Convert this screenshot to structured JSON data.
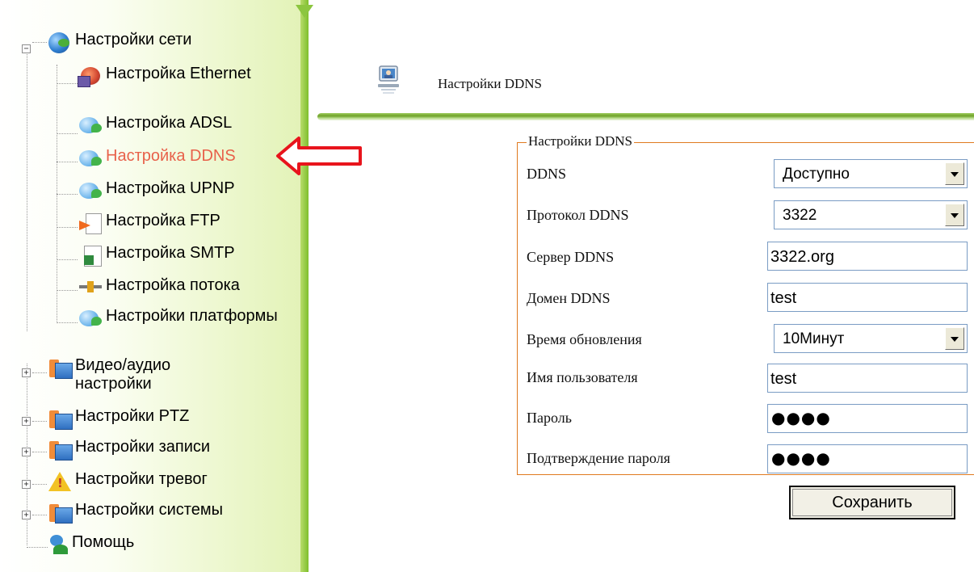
{
  "sidebar": {
    "items": [
      {
        "label": "Настройки сети",
        "icon": "globe-icon",
        "expander": "−"
      },
      {
        "label": "Настройка Ethernet",
        "icon": "ethernet-icon"
      },
      {
        "label": "Настройка ADSL",
        "icon": "bubble-icon"
      },
      {
        "label": "Настройка DDNS",
        "icon": "bubble-icon",
        "active": true
      },
      {
        "label": "Настройка UPNP",
        "icon": "bubble-icon"
      },
      {
        "label": "Настройка FTP",
        "icon": "ftp-icon"
      },
      {
        "label": "Настройка SMTP",
        "icon": "smtp-icon"
      },
      {
        "label": "Настройка потока",
        "icon": "pipe-icon"
      },
      {
        "label": "Настройки платформы",
        "icon": "bubble-icon"
      },
      {
        "label": "Видео/аудио настройки",
        "icon": "folder-icon",
        "expander": "+"
      },
      {
        "label": "Настройки PTZ",
        "icon": "folder-icon",
        "expander": "+"
      },
      {
        "label": "Настройки записи",
        "icon": "folder-icon",
        "expander": "+"
      },
      {
        "label": "Настройки тревог",
        "icon": "warning-icon",
        "expander": "+"
      },
      {
        "label": "Настройки системы",
        "icon": "folder-icon",
        "expander": "+"
      },
      {
        "label": "Помощь",
        "icon": "help-icon"
      }
    ]
  },
  "header": {
    "title": "Настройки DDNS",
    "icon": "network-settings-icon"
  },
  "form": {
    "legend": "Настройки DDNS",
    "ddns_label": "DDNS",
    "ddns_value": "Доступно",
    "protocol_label": "Протокол DDNS",
    "protocol_value": "3322",
    "server_label": "Сервер DDNS",
    "server_value": "3322.org",
    "domain_label": "Домен DDNS",
    "domain_value": "test",
    "update_label": "Время обновления",
    "update_value": "10Минут",
    "username_label": "Имя пользователя",
    "username_value": "test",
    "password_label": "Пароль",
    "password_value": "●●●●",
    "confirm_label": "Подтверждение пароля",
    "confirm_value": "●●●●",
    "save_label": "Сохранить"
  },
  "colors": {
    "active_item": "#e8614a",
    "fieldset_border": "#e07a1f",
    "annotation_arrow": "#e8141c",
    "sidebar_accent": "#8cc63f"
  }
}
